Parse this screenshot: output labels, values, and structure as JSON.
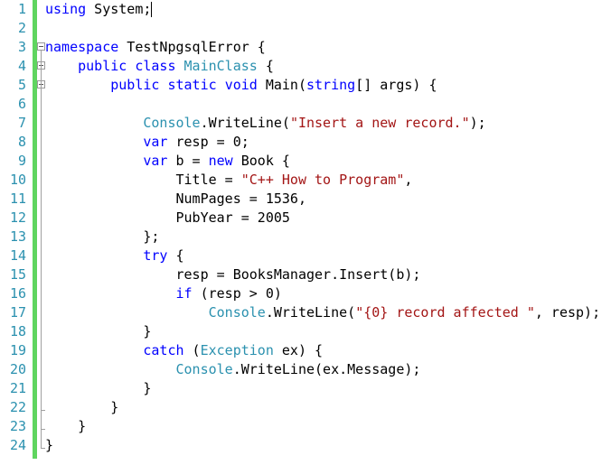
{
  "line_numbers": [
    "1",
    "2",
    "3",
    "4",
    "5",
    "6",
    "7",
    "8",
    "9",
    "10",
    "11",
    "12",
    "13",
    "14",
    "15",
    "16",
    "17",
    "18",
    "19",
    "20",
    "21",
    "22",
    "23",
    "24"
  ],
  "code_lines": [
    [
      {
        "t": "using",
        "c": "kw"
      },
      {
        "t": " System;",
        "c": ""
      }
    ],
    [],
    [
      {
        "t": "namespace",
        "c": "kw"
      },
      {
        "t": " TestNpgsqlError {",
        "c": ""
      }
    ],
    [
      {
        "t": "    ",
        "c": ""
      },
      {
        "t": "public",
        "c": "kw"
      },
      {
        "t": " ",
        "c": ""
      },
      {
        "t": "class",
        "c": "kw"
      },
      {
        "t": " ",
        "c": ""
      },
      {
        "t": "MainClass",
        "c": "ty"
      },
      {
        "t": " {",
        "c": ""
      }
    ],
    [
      {
        "t": "        ",
        "c": ""
      },
      {
        "t": "public",
        "c": "kw"
      },
      {
        "t": " ",
        "c": ""
      },
      {
        "t": "static",
        "c": "kw"
      },
      {
        "t": " ",
        "c": ""
      },
      {
        "t": "void",
        "c": "kw"
      },
      {
        "t": " Main(",
        "c": ""
      },
      {
        "t": "string",
        "c": "kw"
      },
      {
        "t": "[] args) {",
        "c": ""
      }
    ],
    [],
    [
      {
        "t": "            ",
        "c": ""
      },
      {
        "t": "Console",
        "c": "ty"
      },
      {
        "t": ".WriteLine(",
        "c": ""
      },
      {
        "t": "\"Insert a new record.\"",
        "c": "str"
      },
      {
        "t": ");",
        "c": ""
      }
    ],
    [
      {
        "t": "            ",
        "c": ""
      },
      {
        "t": "var",
        "c": "kw"
      },
      {
        "t": " resp = 0;",
        "c": ""
      }
    ],
    [
      {
        "t": "            ",
        "c": ""
      },
      {
        "t": "var",
        "c": "kw"
      },
      {
        "t": " b = ",
        "c": ""
      },
      {
        "t": "new",
        "c": "kw"
      },
      {
        "t": " Book {",
        "c": ""
      }
    ],
    [
      {
        "t": "                Title = ",
        "c": ""
      },
      {
        "t": "\"C++ How to Program\"",
        "c": "str"
      },
      {
        "t": ",",
        "c": ""
      }
    ],
    [
      {
        "t": "                NumPages = 1536,",
        "c": ""
      }
    ],
    [
      {
        "t": "                PubYear = 2005",
        "c": ""
      }
    ],
    [
      {
        "t": "            };",
        "c": ""
      }
    ],
    [
      {
        "t": "            ",
        "c": ""
      },
      {
        "t": "try",
        "c": "kw"
      },
      {
        "t": " {",
        "c": ""
      }
    ],
    [
      {
        "t": "                resp = BooksManager.Insert(b);",
        "c": ""
      }
    ],
    [
      {
        "t": "                ",
        "c": ""
      },
      {
        "t": "if",
        "c": "kw"
      },
      {
        "t": " (resp > 0)",
        "c": ""
      }
    ],
    [
      {
        "t": "                    ",
        "c": ""
      },
      {
        "t": "Console",
        "c": "ty"
      },
      {
        "t": ".WriteLine(",
        "c": ""
      },
      {
        "t": "\"{0} record affected \"",
        "c": "str"
      },
      {
        "t": ", resp);",
        "c": ""
      }
    ],
    [
      {
        "t": "            }",
        "c": ""
      }
    ],
    [
      {
        "t": "            ",
        "c": ""
      },
      {
        "t": "catch",
        "c": "kw"
      },
      {
        "t": " (",
        "c": ""
      },
      {
        "t": "Exception",
        "c": "ty"
      },
      {
        "t": " ex) {",
        "c": ""
      }
    ],
    [
      {
        "t": "                ",
        "c": ""
      },
      {
        "t": "Console",
        "c": "ty"
      },
      {
        "t": ".WriteLine(ex.Message);",
        "c": ""
      }
    ],
    [
      {
        "t": "            }",
        "c": ""
      }
    ],
    [
      {
        "t": "        }",
        "c": ""
      }
    ],
    [
      {
        "t": "    }",
        "c": ""
      }
    ],
    [
      {
        "t": "}",
        "c": ""
      }
    ]
  ],
  "colors": {
    "keyword": "#0000ff",
    "type": "#2b91af",
    "string": "#a31515",
    "line_number": "#2b91af",
    "change_bar": "#5fd55f"
  },
  "icons": [
    "collapse-box-icon"
  ]
}
